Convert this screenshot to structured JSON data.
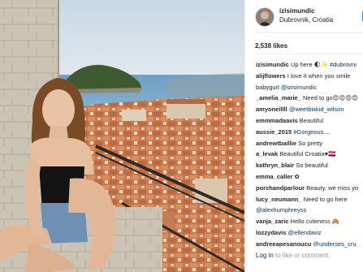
{
  "post": {
    "username": "izisimundic",
    "location": "Dubrovnik, Croatia",
    "follow_label": "F",
    "likes_text": "2,538 likes",
    "comments": [
      {
        "user": "izisimundic",
        "text": "Up here 🌓✨ ",
        "tags": [
          "#dubrovni"
        ]
      },
      {
        "user": "alijflowers",
        "text": "I love it when you smile",
        "line2": "babygurl ",
        "line2_tag": "@izisimundic"
      },
      {
        "user": "_amelia_marie_",
        "text": "Need to go😍😍😍😍"
      },
      {
        "user": "amyoneillll",
        "text": "",
        "tags": [
          "@weetbixkid_wilson"
        ]
      },
      {
        "user": "emmmadaavis",
        "text": "Beautiful"
      },
      {
        "user": "aussie_2015",
        "text": "",
        "tags": [
          "#Gorgeous...."
        ]
      },
      {
        "user": "andrewtbaillie",
        "text": "So pretty"
      },
      {
        "user": "a_levak",
        "text": "Beautiful Croatia♥🇭🇷"
      },
      {
        "user": "kathryn_blair",
        "text": "So beautiful"
      },
      {
        "user": "emma_caller",
        "text": "✿"
      },
      {
        "user": "porchandparlour",
        "text": "Beauty, we miss yo"
      },
      {
        "user": "lucy_neumann_",
        "text": "Need to go here",
        "line2": "",
        "line2_tag": "@alexhumphreyss"
      },
      {
        "user": "vanja_zaric",
        "text": "Hello cuteness 🙈"
      },
      {
        "user": "lozzydavis",
        "text": "",
        "tags": [
          "@ellendaviz"
        ]
      },
      {
        "user": "andreeapesanoucu",
        "text": "",
        "tags": [
          "@underses_cru"
        ]
      }
    ],
    "login_link": "Log in",
    "login_rest": " to like or comment."
  }
}
